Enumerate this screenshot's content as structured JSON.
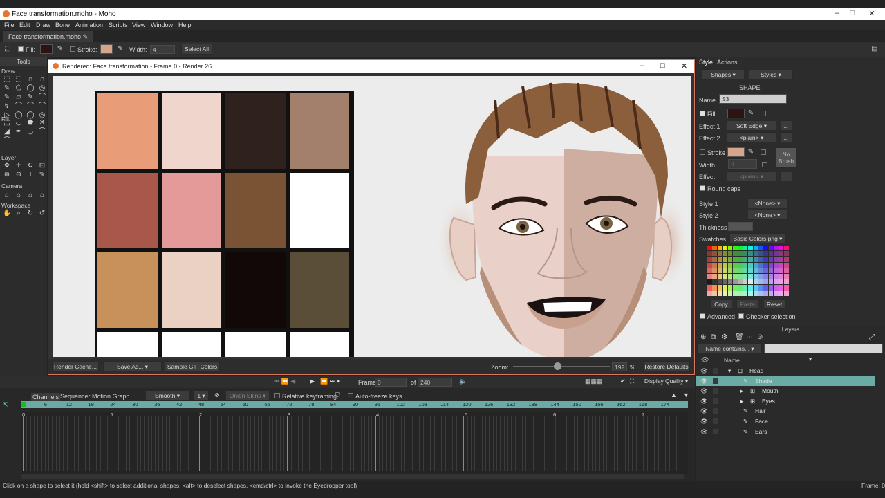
{
  "window": {
    "title": "Face transformation.moho - Moho"
  },
  "menu": [
    "File",
    "Edit",
    "Draw",
    "Bone",
    "Animation",
    "Scripts",
    "View",
    "Window",
    "Help"
  ],
  "doc_tab": "Face transformation.moho",
  "toolbar": {
    "fill_label": "Fill:",
    "stroke_label": "Stroke:",
    "width_label": "Width:",
    "width_value": "4",
    "select_all": "Select All",
    "fill_color": "#2a1414",
    "stroke_color": "#d6a68a"
  },
  "tools": {
    "title": "Tools",
    "sections": [
      "Draw",
      "Fill",
      "Layer",
      "Camera",
      "Workspace"
    ]
  },
  "render_window": {
    "title": "Rendered: Face transformation - Frame 0 - Render 26",
    "render_cache": "Render Cache...",
    "save_as": "Save As...",
    "sample_gif": "Sample GIF Colors",
    "zoom_label": "Zoom:",
    "zoom_value": "192",
    "zoom_unit": "%",
    "restore": "Restore Defaults",
    "palette_colors": [
      "#e99c78",
      "#efd5cc",
      "#2f221e",
      "#a2806b",
      "#a8574a",
      "#e59a9a",
      "#7a5335",
      "#ffffff",
      "#c8905a",
      "#ead1c3",
      "#120808",
      "#5a4e38"
    ]
  },
  "right_panel": {
    "tabs": [
      "Style",
      "Actions"
    ],
    "shapes_dd": "Shapes",
    "styles_dd": "Styles",
    "section": "SHAPE",
    "name_label": "Name",
    "name_value": "S3",
    "fill_label": "Fill",
    "effect1_label": "Effect 1",
    "effect1_value": "Soft Edge",
    "effect2_label": "Effect 2",
    "effect2_value": "<plain>",
    "stroke_label": "Stroke",
    "no_brush": "No Brush",
    "width_label": "Width",
    "width_value": "4",
    "effect_label": "Effect",
    "effect_value": "<plain>",
    "round_caps": "Round caps",
    "style1_label": "Style 1",
    "style1_value": "<None>",
    "style2_label": "Style 2",
    "style2_value": "<None>",
    "thickness_label": "Thickness",
    "swatches_label": "Swatches",
    "swatches_value": "Basic Colors.png",
    "copy": "Copy",
    "paste": "Paste",
    "reset": "Reset",
    "advanced": "Advanced",
    "checker": "Checker selection",
    "fill_color": "#2a1414",
    "stroke_color": "#d6a68a"
  },
  "layers": {
    "title": "Layers",
    "filter": "Name contains...",
    "col_name": "Name",
    "items": [
      {
        "name": "Head"
      },
      {
        "name": "Shade"
      },
      {
        "name": "Mouth"
      },
      {
        "name": "Eyes"
      },
      {
        "name": "Hair"
      },
      {
        "name": "Face"
      },
      {
        "name": "Ears"
      }
    ]
  },
  "playback": {
    "frame_label": "Frame",
    "frame_value": "0",
    "of_label": "of",
    "total": "240",
    "display_quality": "Display Quality"
  },
  "timeline": {
    "tabs": [
      "Channels",
      "Sequencer",
      "Motion Graph"
    ],
    "interp": "Smooth",
    "interp_n": "1",
    "onion": "Onion Skins",
    "relative": "Relative keyframing",
    "autofreeze": "Auto-freeze keys",
    "ticks": [
      "0",
      "6",
      "12",
      "18",
      "24",
      "30",
      "36",
      "42",
      "48",
      "54",
      "60",
      "66",
      "72",
      "78",
      "84",
      "90",
      "96",
      "102",
      "108",
      "114",
      "120",
      "126",
      "132",
      "138",
      "144",
      "150",
      "156",
      "162",
      "168",
      "174"
    ],
    "seconds": [
      "0",
      "1",
      "2",
      "3",
      "4",
      "5",
      "6",
      "7"
    ]
  },
  "status": {
    "hint": "Click on a shape to select it (hold <shift> to select additional shapes, <alt> to deselect shapes, <cmd/ctrl> to invoke the Eyedropper tool)",
    "frame": "Frame: 0"
  }
}
